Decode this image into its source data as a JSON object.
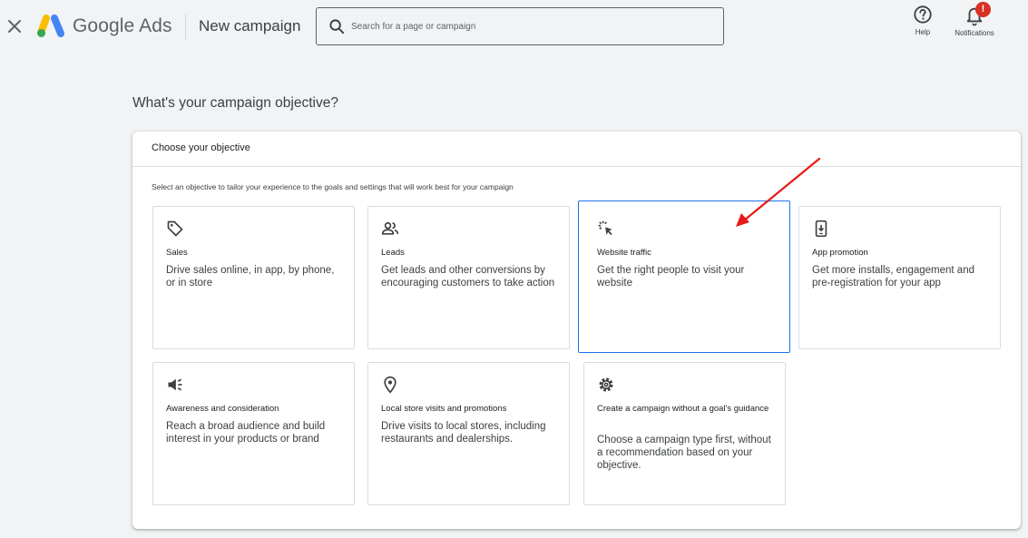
{
  "app": {
    "brand": "Google Ads",
    "page_title": "New campaign"
  },
  "search": {
    "placeholder": "Search for a page or campaign"
  },
  "toolbar": {
    "help_label": "Help",
    "notifications_label": "Notifications",
    "notifications_badge": "!"
  },
  "main": {
    "question": "What's your campaign objective?",
    "card_header": "Choose your objective",
    "instruction": "Select an objective to tailor your experience to the goals and settings that will work best for your campaign"
  },
  "objectives": [
    {
      "title": "Sales",
      "description": "Drive sales online, in app, by phone, or in store",
      "icon": "tag-icon",
      "selected": false
    },
    {
      "title": "Leads",
      "description": "Get leads and other conversions by encouraging customers to take action",
      "icon": "people-icon",
      "selected": false
    },
    {
      "title": "Website traffic",
      "description": "Get the right people to visit your website",
      "icon": "cursor-click-icon",
      "selected": true
    },
    {
      "title": "App promotion",
      "description": "Get more installs, engagement and pre-registration for your app",
      "icon": "phone-download-icon",
      "selected": false
    },
    {
      "title": "Awareness and consideration",
      "description": "Reach a broad audience and build interest in your products or brand",
      "icon": "megaphone-icon",
      "selected": false
    },
    {
      "title": "Local store visits and promotions",
      "description": "Drive visits to local stores, including restaurants and dealerships.",
      "icon": "location-pin-icon",
      "selected": false
    },
    {
      "title": "Create a campaign without a goal's guidance",
      "description": "Choose a campaign type first, without a recommendation based on your objective.",
      "icon": "gear-icon",
      "selected": false
    }
  ],
  "colors": {
    "accent": "#1a73e8",
    "badge": "#d93025",
    "annotation_arrow": "#e8191a",
    "background": "#f1f3f4"
  }
}
